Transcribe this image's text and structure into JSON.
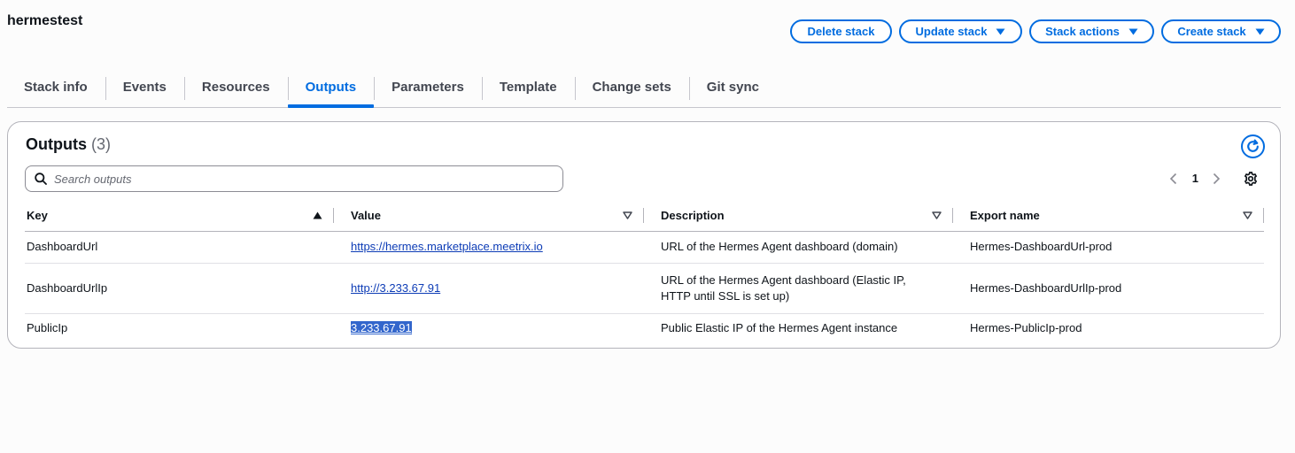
{
  "stack": {
    "name": "hermestest"
  },
  "actions": {
    "delete": "Delete stack",
    "update": "Update stack",
    "stack_actions": "Stack actions",
    "create": "Create stack"
  },
  "tabs": [
    {
      "label": "Stack info",
      "active": false
    },
    {
      "label": "Events",
      "active": false
    },
    {
      "label": "Resources",
      "active": false
    },
    {
      "label": "Outputs",
      "active": true
    },
    {
      "label": "Parameters",
      "active": false
    },
    {
      "label": "Template",
      "active": false
    },
    {
      "label": "Change sets",
      "active": false
    },
    {
      "label": "Git sync",
      "active": false
    }
  ],
  "outputs": {
    "title": "Outputs",
    "count": "(3)",
    "search_placeholder": "Search outputs",
    "page": "1",
    "columns": {
      "key": "Key",
      "value": "Value",
      "description": "Description",
      "export_name": "Export name"
    },
    "rows": [
      {
        "key": "DashboardUrl",
        "value": "https://hermes.marketplace.meetrix.io",
        "description": "URL of the Hermes Agent dashboard (domain)",
        "export_name": "Hermes-DashboardUrl-prod"
      },
      {
        "key": "DashboardUrlIp",
        "value": "http://3.233.67.91",
        "description": "URL of the Hermes Agent dashboard (Elastic IP, HTTP until SSL is set up)",
        "export_name": "Hermes-DashboardUrlIp-prod"
      },
      {
        "key": "PublicIp",
        "value": "3.233.67.91",
        "description": "Public Elastic IP of the Hermes Agent instance",
        "export_name": "Hermes-PublicIp-prod"
      }
    ]
  },
  "colors": {
    "accent": "#006ce0",
    "link": "#0d3cb6",
    "selection": "#3366cc",
    "text": "#0f141a",
    "border": "#b4b4bb"
  }
}
